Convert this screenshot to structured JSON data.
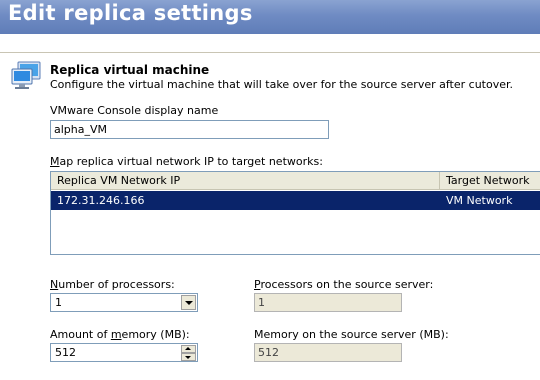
{
  "header": {
    "title": "Edit replica settings"
  },
  "section": {
    "title": "Replica virtual machine",
    "description": "Configure the virtual machine that will take over for the source server after cutover."
  },
  "display_name": {
    "label": "VMware Console display name",
    "value": "alpha_VM"
  },
  "network_map": {
    "label_prefix": "",
    "label_hotkey": "M",
    "label_rest": "ap replica virtual network IP to target networks:",
    "columns": [
      "Replica VM Network IP",
      "Target Network"
    ],
    "rows": [
      {
        "ip": "172.31.246.166",
        "network": "VM Network",
        "selected": true
      }
    ]
  },
  "processors": {
    "label_hotkey": "N",
    "label_rest": "umber of processors:",
    "value": "1",
    "source_label_hotkey": "P",
    "source_label_rest": "rocessors on the source server:",
    "source_value": "1"
  },
  "memory": {
    "label_prefix": "Amount of ",
    "label_hotkey": "m",
    "label_rest": "emory (MB):",
    "value": "512",
    "source_label": "Memory on the source server (MB):",
    "source_value": "512"
  },
  "colors": {
    "header_blue": "#6f8bc3",
    "selection": "#0a246a",
    "readonly_bg": "#ece9d8"
  }
}
